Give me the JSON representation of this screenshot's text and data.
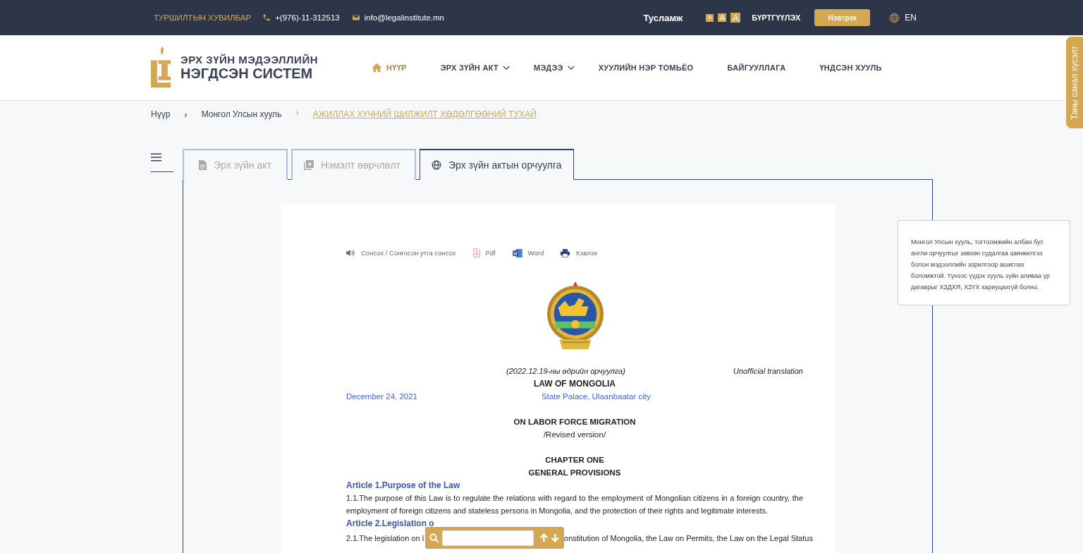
{
  "top_bar": {
    "badge": "ТУРШИЛТЫН ХУВИЛБАР",
    "phone": "+(976)-11-312513",
    "email": "info@legalinstitute.mn",
    "help": "Тусламж",
    "font_sizes": [
      "A",
      "A",
      "A"
    ],
    "register": "БҮРТГҮҮЛЭХ",
    "login": "Нэвтрэх",
    "language": "EN"
  },
  "header": {
    "logo_line1": "ЭРХ ЗҮЙН МЭДЭЭЛЛИЙН",
    "logo_line2": "НЭГДСЭН СИСТЕМ",
    "nav": [
      {
        "label": "НҮҮР",
        "kind": "home",
        "dropdown": false
      },
      {
        "label": "ЭРХ ЗҮЙН АКТ",
        "kind": "link",
        "dropdown": true
      },
      {
        "label": "МЭДЭЭ",
        "kind": "link",
        "dropdown": true
      },
      {
        "label": "ХУУЛИЙН НЭР ТОМЬЁО",
        "kind": "link",
        "dropdown": false
      },
      {
        "label": "БАЙГУУЛЛАГА",
        "kind": "link",
        "dropdown": false
      },
      {
        "label": "ҮНДСЭН ХУУЛЬ",
        "kind": "link",
        "dropdown": false
      }
    ]
  },
  "feedback_tab": "Таны санал хүсэлт",
  "breadcrumb": [
    {
      "label": "Нүүр",
      "current": false
    },
    {
      "separator": "›",
      "label": "Монгол Улсын хууль",
      "current": false
    },
    {
      "separator": "›",
      "label": "АЖИЛЛАХ ХҮЧНИЙ ШИЛЖИЛТ ХӨДӨЛГӨӨНИЙ ТУХАЙ",
      "current": true
    }
  ],
  "tabs": [
    {
      "label": "Эрх зүйн акт",
      "selected": false
    },
    {
      "label": "Нэмэлт өөрчлөлт",
      "selected": false
    },
    {
      "label": "Эрх зүйн актын орчуулга",
      "selected": true
    }
  ],
  "document": {
    "toolbar": [
      {
        "label": "Сонсох / Сонгосон утга сонсох",
        "kind": "audio"
      },
      {
        "label": "Pdf",
        "kind": "pdf"
      },
      {
        "label": "Word",
        "kind": "word"
      },
      {
        "label": "Хэвлэх",
        "kind": "print"
      }
    ],
    "translation_date": "(2022.12.19-ны өдрийн орчуулга)",
    "unofficial": "Unofficial translation",
    "law_title": "LAW OF MONGOLIA",
    "date": "December 24, 2021",
    "place": "State Palace, Ulaanbaatar city",
    "blocks": [
      {
        "kind": "title",
        "text": "ON LABOR FORCE MIGRATION"
      },
      {
        "kind": "subtitle",
        "text": "/Revised version/"
      },
      {
        "kind": "spacer"
      },
      {
        "kind": "title",
        "text": "CHAPTER ONE"
      },
      {
        "kind": "title",
        "text": "GENERAL PROVISIONS"
      },
      {
        "kind": "article",
        "text": "Article 1.Purpose of the Law"
      },
      {
        "kind": "para",
        "text": "1.1.The purpose of this Law is to regulate the relations with regard to the employment of Mongolian citizens in a foreign country, the employment of foreign citizens and stateless persons in Mongolia, and the protection of their rights and legitimate interests."
      },
      {
        "kind": "article",
        "text": "Article 2.Legislation o"
      },
      {
        "kind": "split",
        "parts": [
          "2.1.The legislation on l",
          "onstitution of Mongolia, the Law on Permits, the Law on the Legal Status"
        ]
      }
    ]
  },
  "notice": "Монгол Улсын хууль, тогтоомжийн албан бус англи орчуулгыг зөвхөн судалгаа шинжилгээ болон мэдээллийн зорилгоор ашиглах боломжтой. Үүнээс үүдэх хууль зүйн аливаа үр дагаврыг ХЗДХЯ, ХЗҮХ хариуцахгүй болно."
}
